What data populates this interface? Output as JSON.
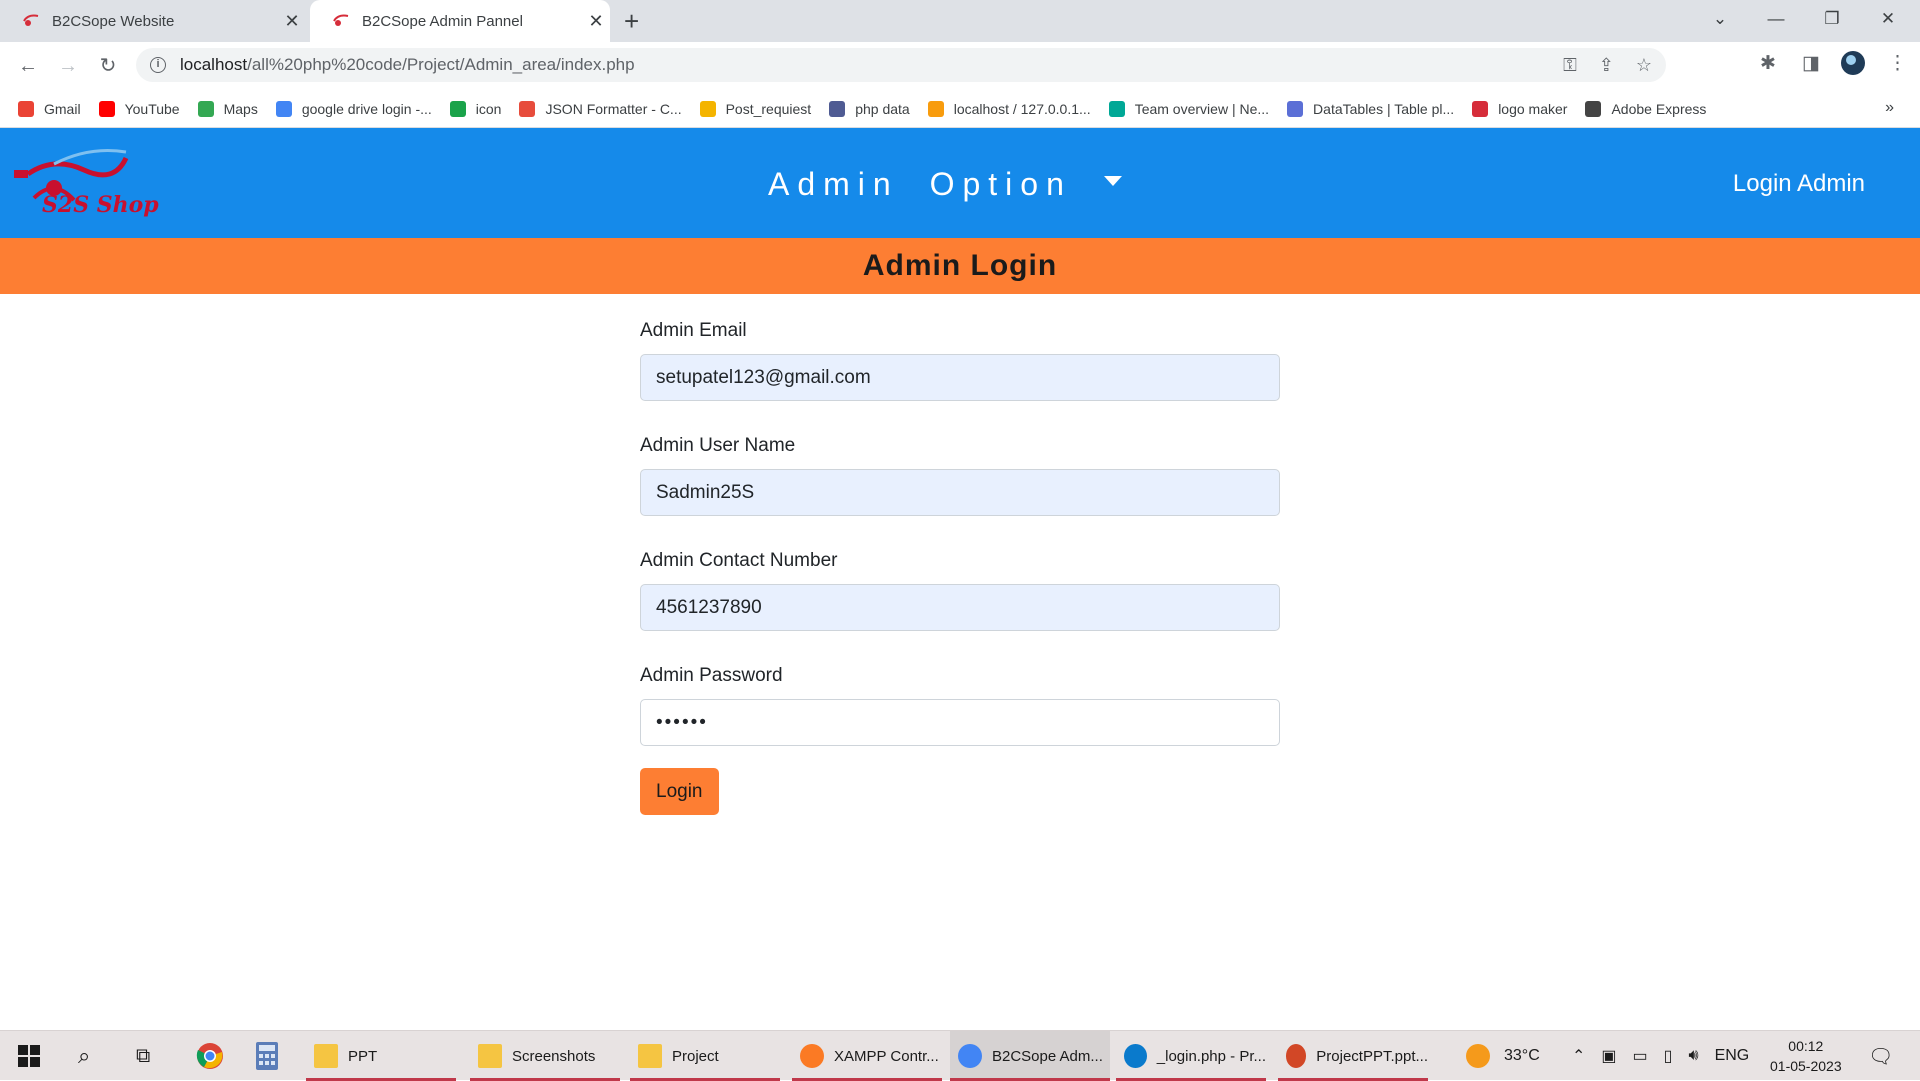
{
  "browser": {
    "tabs": [
      {
        "title": "B2CSope Website",
        "active": false
      },
      {
        "title": "B2CSope Admin Pannel",
        "active": true
      }
    ],
    "new_tab": "+",
    "tab_close": "✕",
    "url_host": "localhost",
    "url_path": "/all%20php%20code/Project/Admin_area/index.php",
    "window_controls": {
      "tab_search": "⌄",
      "minimize": "—",
      "restore": "❐",
      "close": "✕"
    },
    "bookmarks": [
      {
        "label": "Gmail",
        "color": "#ea4335"
      },
      {
        "label": "YouTube",
        "color": "#ff0000"
      },
      {
        "label": "Maps",
        "color": "#34a853"
      },
      {
        "label": "google drive login -...",
        "color": "#4285f4"
      },
      {
        "label": "icon",
        "color": "#1aa34a"
      },
      {
        "label": "JSON Formatter - C...",
        "color": "#e74c3c"
      },
      {
        "label": "Post_requiest",
        "color": "#f4b400"
      },
      {
        "label": "php data",
        "color": "#4f5b93"
      },
      {
        "label": "localhost / 127.0.0.1...",
        "color": "#f89c0e"
      },
      {
        "label": "Team overview | Ne...",
        "color": "#00a896"
      },
      {
        "label": "DataTables | Table pl...",
        "color": "#5b6fd6"
      },
      {
        "label": "logo maker",
        "color": "#d62d3a"
      },
      {
        "label": "Adobe Express",
        "color": "#444444"
      }
    ],
    "bookmarks_more": "»"
  },
  "site": {
    "logo_text": "S2S Shop",
    "nav_title": "Admin Option",
    "login_link": "Login Admin",
    "heading": "Admin Login",
    "colors": {
      "navbar": "#158aea",
      "accent": "#fd7e33"
    }
  },
  "form": {
    "email_label": "Admin Email",
    "email_value": "setupatel123@gmail.com",
    "username_label": "Admin User Name",
    "username_value": "Sadmin25S",
    "contact_label": "Admin Contact Number",
    "contact_value": "4561237890",
    "password_label": "Admin Password",
    "password_value": "••••••",
    "submit_label": "Login"
  },
  "taskbar": {
    "apps": [
      {
        "label": "PPT",
        "icon": "folder-icon"
      },
      {
        "label": "Screenshots",
        "icon": "folder-icon"
      },
      {
        "label": "Project",
        "icon": "folder-icon"
      },
      {
        "label": "XAMPP Contr...",
        "icon": "xampp-icon"
      },
      {
        "label": "B2CSope Adm...",
        "icon": "chrome-icon"
      },
      {
        "label": "_login.php - Pr...",
        "icon": "vscode-icon"
      },
      {
        "label": "ProjectPPT.ppt...",
        "icon": "powerpoint-icon"
      }
    ],
    "weather": "33°C",
    "language": "ENG",
    "time": "00:12",
    "date": "01-05-2023"
  }
}
